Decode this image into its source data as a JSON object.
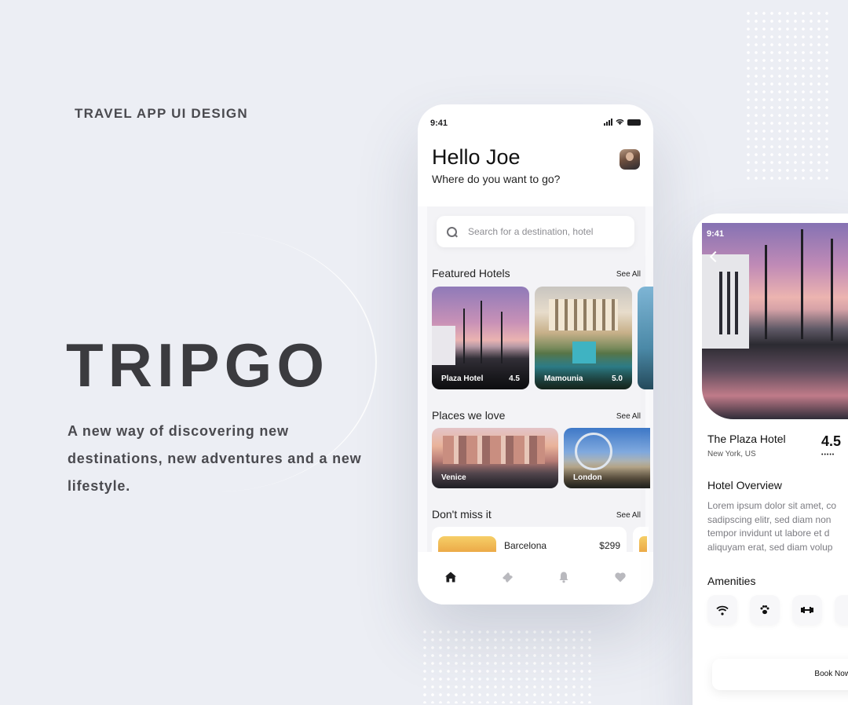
{
  "hero": {
    "eyebrow": "TRAVEL APP UI DESIGN",
    "brand": "TRIPGO",
    "tagline": "A new way of discovering new destinations, new adventures and a new lifestyle."
  },
  "phone_home": {
    "status_time": "9:41",
    "greeting": "Hello Joe",
    "subtitle": "Where do you want to go?",
    "search_placeholder": "Search for a destination, hotel",
    "featured": {
      "title": "Featured Hotels",
      "see_all": "See All",
      "cards": [
        {
          "name": "Plaza Hotel",
          "rating": "4.5"
        },
        {
          "name": "Mamounia",
          "rating": "5.0"
        }
      ]
    },
    "places": {
      "title": "Places we love",
      "see_all": "See All",
      "cards": [
        {
          "name": "Venice"
        },
        {
          "name": "London"
        }
      ]
    },
    "deals": {
      "title": "Don't miss it",
      "see_all": "See All",
      "items": [
        {
          "name": "Barcelona",
          "price": "$299"
        }
      ]
    },
    "tabs": [
      "home-icon",
      "ticket-icon",
      "bell-icon",
      "heart-icon"
    ],
    "colors": {
      "active_tab": "#1d1d1f",
      "inactive_tab": "#b9b9be"
    }
  },
  "phone_detail": {
    "status_time": "9:41",
    "hotel_name": "The Plaza Hotel",
    "location": "New York, US",
    "rating": "4.5",
    "stars": "•••••",
    "overview_title": "Hotel Overview",
    "overview_text": "Lorem ipsum dolor sit amet, co\nsadipscing elitr, sed diam non\ntempor invidunt ut labore et d\naliquyam erat, sed diam volup",
    "amenities_title": "Amenities",
    "amenities": [
      "wifi-icon",
      "paw-icon",
      "dumbbell-icon"
    ],
    "book_label": "Book Now"
  }
}
